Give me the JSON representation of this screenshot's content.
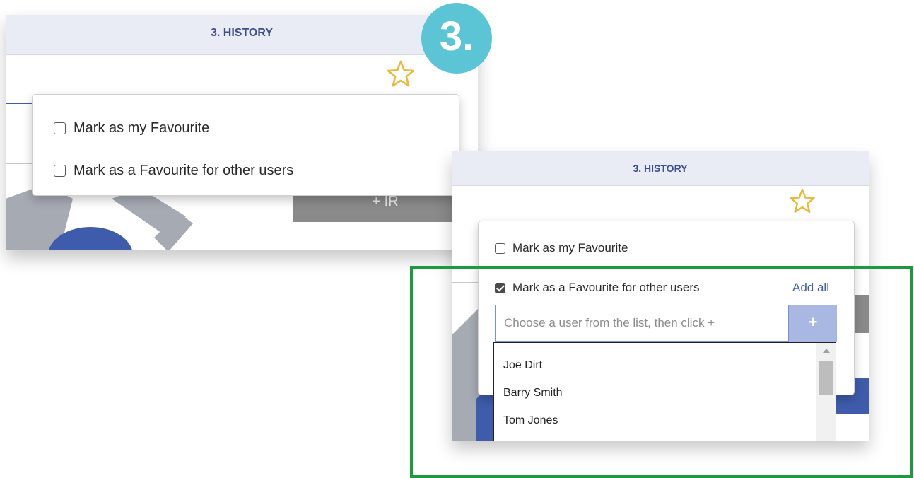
{
  "step_badge": "3.",
  "history_title": "3. HISTORY",
  "panel_before": {
    "option_my_favourite": "Mark as my Favourite",
    "option_other_users": "Mark as a Favourite for other users",
    "ir_button": "+ IR"
  },
  "panel_after": {
    "option_my_favourite": "Mark as my Favourite",
    "option_other_users": "Mark as a Favourite for other users",
    "add_all": "Add all",
    "user_input_placeholder": "Choose a user from the list, then click +",
    "add_button": "+",
    "users": [
      "Joe Dirt",
      "Barry Smith",
      "Tom Jones"
    ]
  },
  "colors": {
    "header_bg": "#e9ecf5",
    "title": "#3f4f8c",
    "accent_blue": "#3e5cab",
    "star": "#e8b93a",
    "badge": "#5bc5d6",
    "highlight_border": "#1d9a3f"
  }
}
